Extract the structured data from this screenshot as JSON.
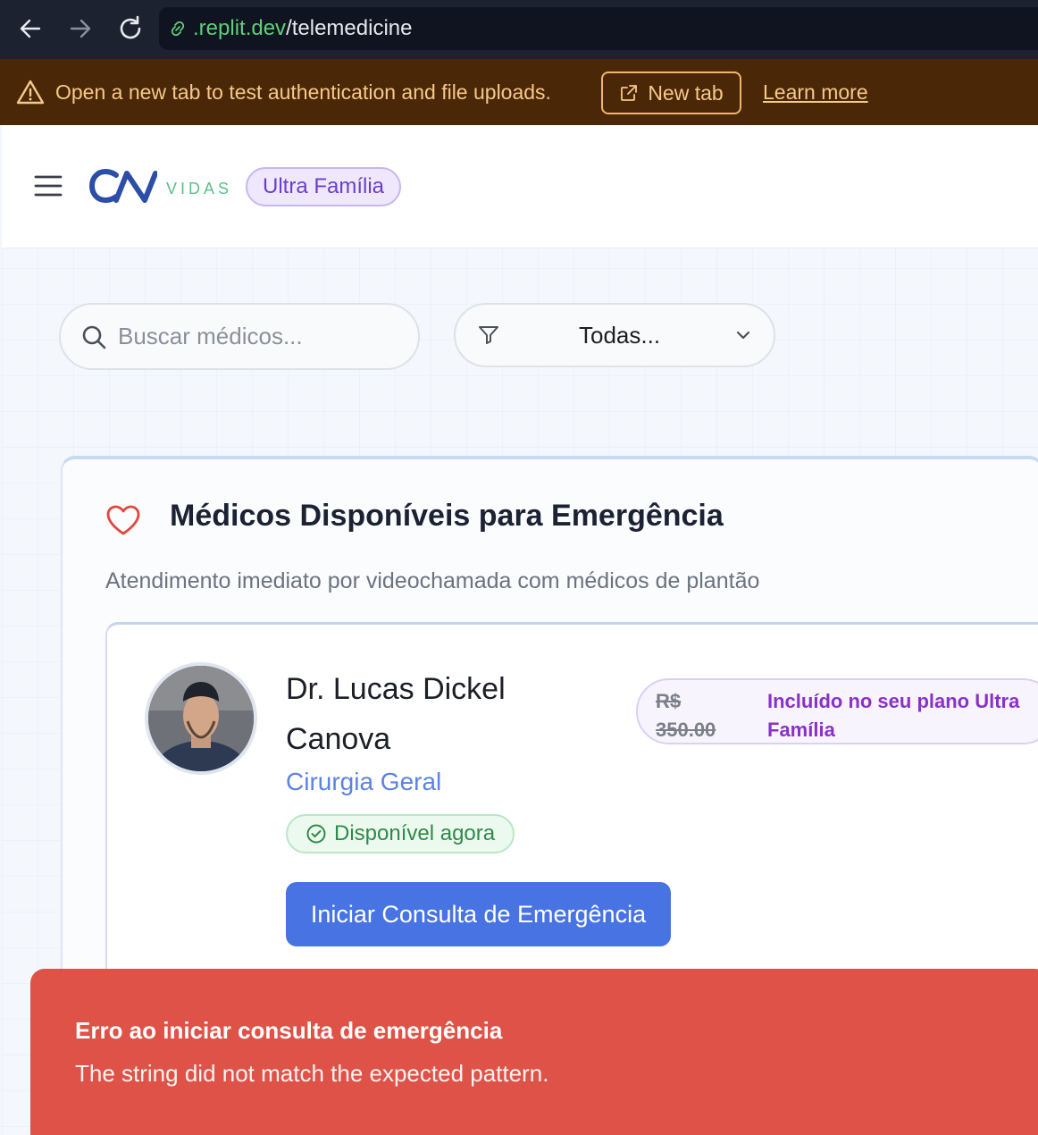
{
  "browser": {
    "url_host": ".replit.dev",
    "url_path": "/telemedicine"
  },
  "banner": {
    "message": "Open a new tab to test authentication and file uploads.",
    "new_tab_label": "New tab",
    "learn_more_label": "Learn more"
  },
  "header": {
    "logo_sub": "VIDAS",
    "plan_badge": "Ultra Família"
  },
  "filters": {
    "search_placeholder": "Buscar médicos...",
    "category_value": "Todas..."
  },
  "emergency": {
    "title": "Médicos Disponíveis para Emergência",
    "subtitle": "Atendimento imediato por videochamada com médicos de plantão",
    "doctor": {
      "name": "Dr. Lucas Dickel Canova",
      "specialty": "Cirurgia Geral",
      "status": "Disponível agora",
      "price_old": "R$ 350.00",
      "price_included": "Incluído no seu plano Ultra Família",
      "cta_label": "Iniciar Consulta de Emergência"
    }
  },
  "toast": {
    "title": "Erro ao iniciar consulta de emergência",
    "message": "The string did not match the expected pattern."
  },
  "colors": {
    "primary": "#4773e3",
    "plan_purple": "#6a3fc8",
    "success": "#2e8a47",
    "error": "#de5248",
    "warning_bg": "#4a2706"
  }
}
